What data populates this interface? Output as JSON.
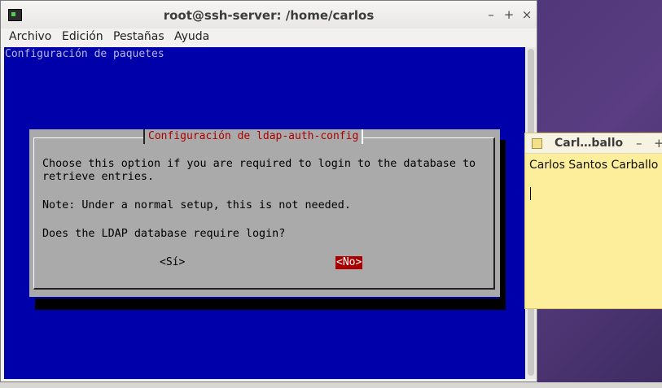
{
  "terminal": {
    "title": "root@ssh-server: /home/carlos",
    "window_buttons": {
      "minimize": "–",
      "maximize": "+",
      "close": "×"
    },
    "menu": [
      "Archivo",
      "Edición",
      "Pestañas",
      "Ayuda"
    ],
    "header": "Configuración de paquetes",
    "background_color": "#0000aa"
  },
  "dialog": {
    "title": "Configuración de ldap-auth-config",
    "lines": [
      "Choose this option if you are required to login to the database to",
      "retrieve entries.",
      "Note: Under a normal setup, this is not needed.",
      "Does the LDAP database require login?"
    ],
    "yes_label": "<Sí>",
    "no_label": "<No>",
    "selected": "no"
  },
  "note": {
    "title": "Carl…ballo",
    "buttons": {
      "minimize": "–",
      "maximize": "+"
    },
    "text": "Carlos Santos Carballo"
  }
}
